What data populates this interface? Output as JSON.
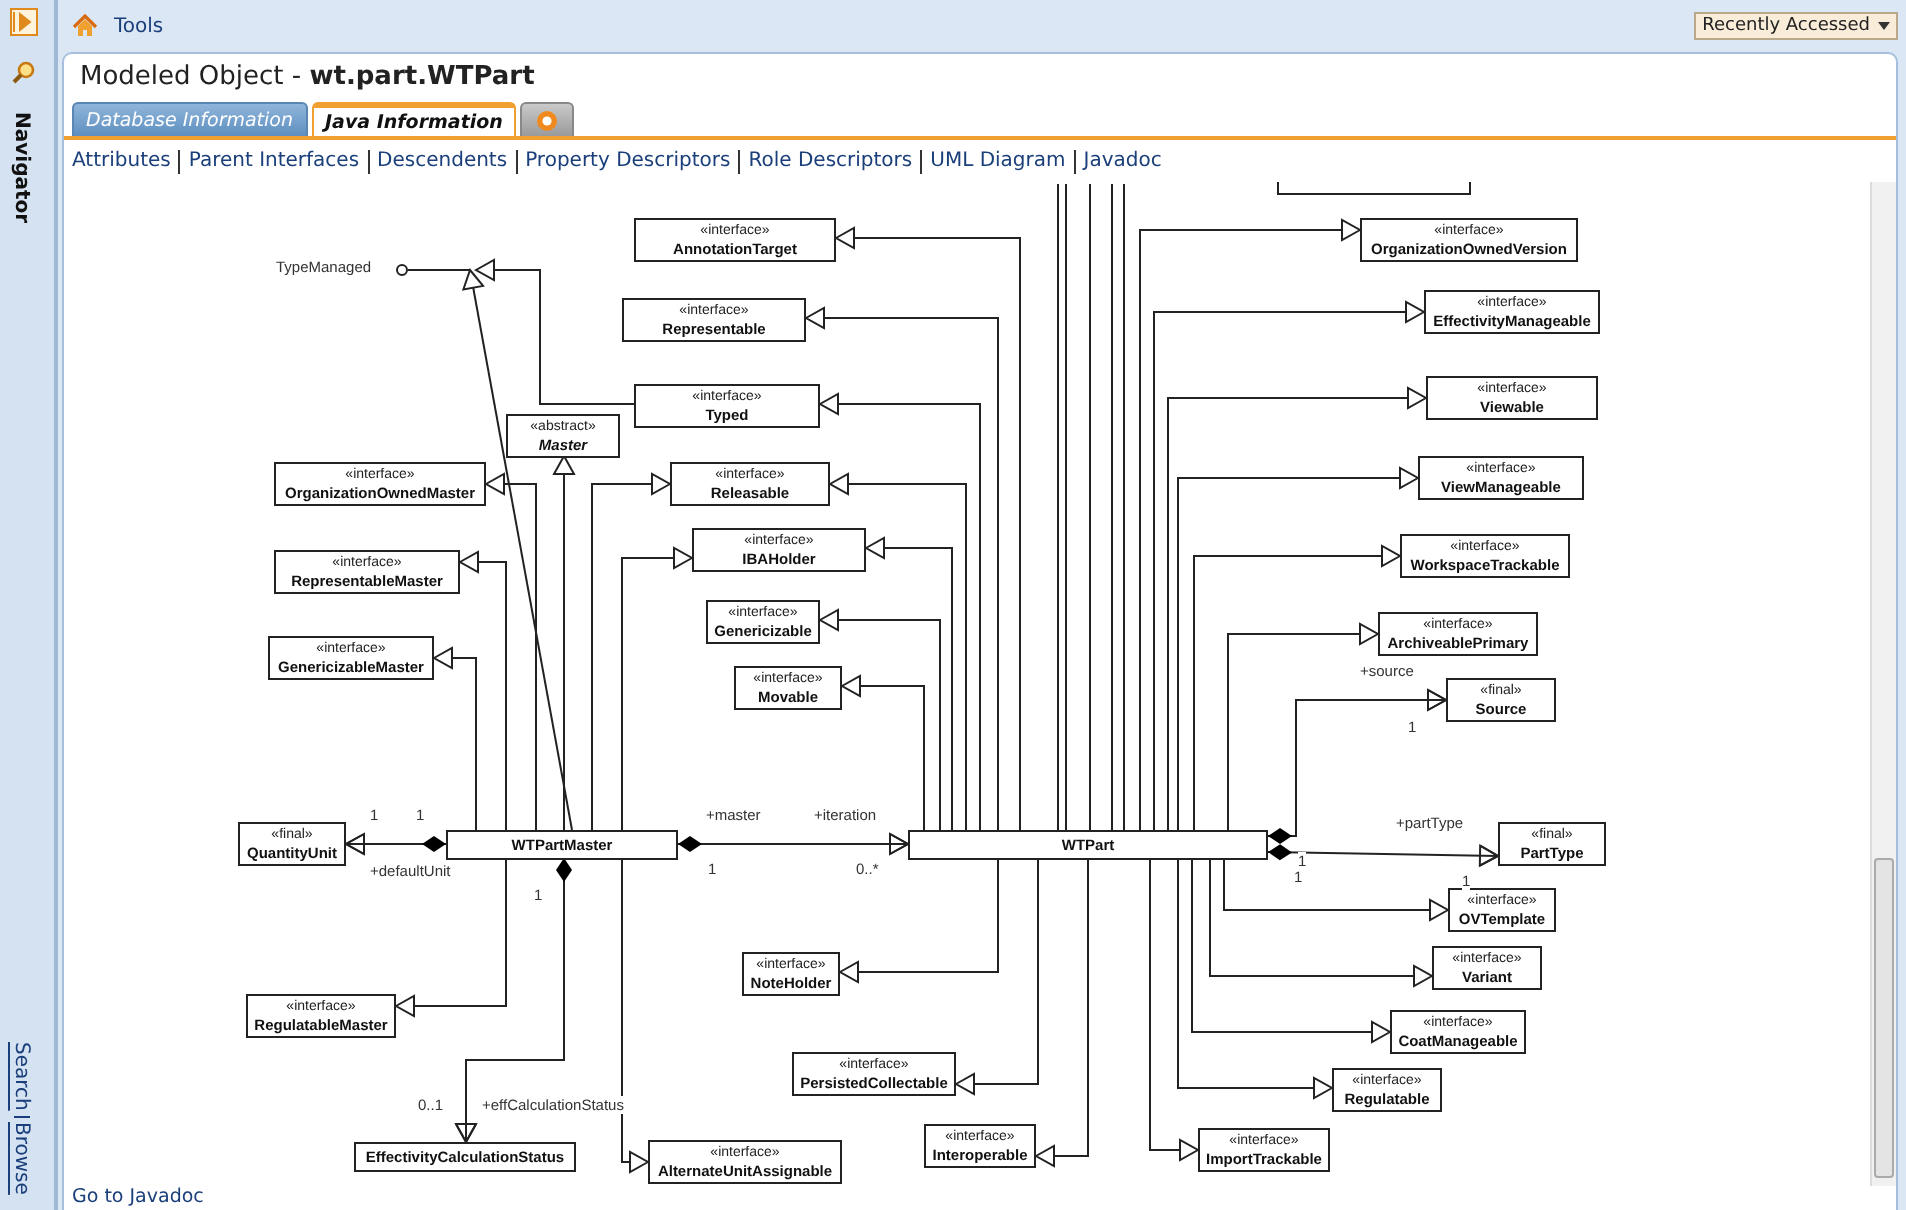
{
  "navigator": {
    "title": "Navigator",
    "bottom_links": [
      "Search",
      "Browse"
    ]
  },
  "top_bar": {
    "breadcrumb": "Tools",
    "recent_dropdown": "Recently Accessed"
  },
  "header": {
    "title": "Modeled Object - **wt.part.WTPart**"
  },
  "tabs": [
    {
      "kind": "text",
      "label": "Database Information",
      "selected": false
    },
    {
      "kind": "text",
      "label": "Java Information",
      "selected": true
    },
    {
      "kind": "icon",
      "selected": false
    }
  ],
  "links": [
    "Attributes",
    "Parent Interfaces",
    "Descendents",
    "Property Descriptors",
    "Role Descriptors",
    "UML Diagram",
    "Javadoc"
  ],
  "diagram": {
    "classes": [
      {
        "kind": "interface",
        "stereotype": "«interface»",
        "name": "AnnotationTarget"
      },
      {
        "kind": "interface",
        "stereotype": "«interface»",
        "name": "OrganizationOwnedVersion"
      },
      {
        "kind": "interface",
        "stereotype": "«interface»",
        "name": "Representable"
      },
      {
        "kind": "interface",
        "stereotype": "«interface»",
        "name": "EffectivityManageable"
      },
      {
        "kind": "interface",
        "stereotype": "«interface»",
        "name": "Typed"
      },
      {
        "kind": "interface",
        "stereotype": "«interface»",
        "name": "Viewable"
      },
      {
        "kind": "abstract",
        "stereotype": "«abstract»",
        "name": "Master"
      },
      {
        "kind": "interface",
        "stereotype": "«interface»",
        "name": "OrganizationOwnedMaster"
      },
      {
        "kind": "interface",
        "stereotype": "«interface»",
        "name": "Releasable"
      },
      {
        "kind": "interface",
        "stereotype": "«interface»",
        "name": "ViewManageable"
      },
      {
        "kind": "interface",
        "stereotype": "«interface»",
        "name": "IBAHolder"
      },
      {
        "kind": "interface",
        "stereotype": "«interface»",
        "name": "WorkspaceTrackable"
      },
      {
        "kind": "interface",
        "stereotype": "«interface»",
        "name": "RepresentableMaster"
      },
      {
        "kind": "interface",
        "stereotype": "«interface»",
        "name": "Genericizable"
      },
      {
        "kind": "interface",
        "stereotype": "«interface»",
        "name": "ArchiveablePrimary"
      },
      {
        "kind": "interface",
        "stereotype": "«interface»",
        "name": "GenericizableMaster"
      },
      {
        "kind": "interface",
        "stereotype": "«interface»",
        "name": "Movable"
      },
      {
        "kind": "final",
        "stereotype": "«final»",
        "name": "Source"
      },
      {
        "kind": "final",
        "stereotype": "«final»",
        "name": "QuantityUnit"
      },
      {
        "kind": "class",
        "name": "WTPartMaster"
      },
      {
        "kind": "class",
        "name": "WTPart"
      },
      {
        "kind": "final",
        "stereotype": "«final»",
        "name": "PartType"
      },
      {
        "kind": "interface",
        "stereotype": "«interface»",
        "name": "OVTemplate"
      },
      {
        "kind": "interface",
        "stereotype": "«interface»",
        "name": "NoteHolder"
      },
      {
        "kind": "interface",
        "stereotype": "«interface»",
        "name": "Variant"
      },
      {
        "kind": "interface",
        "stereotype": "«interface»",
        "name": "RegulatableMaster"
      },
      {
        "kind": "interface",
        "stereotype": "«interface»",
        "name": "CoatManageable"
      },
      {
        "kind": "interface",
        "stereotype": "«interface»",
        "name": "PersistedCollectable"
      },
      {
        "kind": "interface",
        "stereotype": "«interface»",
        "name": "Regulatable"
      },
      {
        "kind": "class",
        "name": "EffectivityCalculationStatus"
      },
      {
        "kind": "interface",
        "stereotype": "«interface»",
        "name": "AlternateUnitAssignable"
      },
      {
        "kind": "interface",
        "stereotype": "«interface»",
        "name": "Interoperable"
      },
      {
        "kind": "interface",
        "stereotype": "«interface»",
        "name": "ImportTrackable"
      }
    ],
    "labels": [
      "TypeManaged",
      "1",
      "1",
      "+defaultUnit",
      "+master",
      "+iteration",
      "1",
      "0..*",
      "1",
      "0..1",
      "+effCalculationStatus",
      "+source",
      "1",
      "+partType",
      "1",
      "1",
      "1"
    ]
  },
  "footer_link": "Go to Javadoc"
}
